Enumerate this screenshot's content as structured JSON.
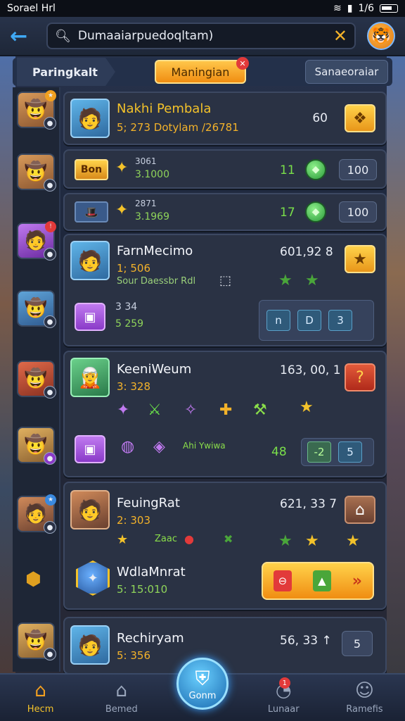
{
  "status": {
    "carrier": "Sorael Hrl",
    "signal": "1/6"
  },
  "search": {
    "query": "Dumaaiarpuedoqltam)"
  },
  "tabs": {
    "left": "Paringkalt",
    "middle": "Maningian",
    "right": "Sanaeoraiar",
    "middle_badge": "✕"
  },
  "rows": [
    {
      "name": "Nakhi Pembala",
      "sub": "5; 273 Dotylam /26781",
      "score": "60"
    },
    {
      "label": "Bon",
      "line1": "3061",
      "line2": "3.1000",
      "gems": "11",
      "pill": "100"
    },
    {
      "line1": "2871",
      "line2": "3.1969",
      "gems": "17",
      "pill": "100"
    },
    {
      "name": "FarnMecimo",
      "sub": "1; 506",
      "desc": "Sour Daessbr Rdl",
      "score": "601,92 8",
      "r1": "3 34",
      "r2": "5 259",
      "slots": [
        "n",
        "D",
        "3"
      ]
    },
    {
      "name": "KeeniWeum",
      "sub": "3: 328",
      "score": "163, 00, 1",
      "items_label": "Ahi Ywiwa",
      "count": "48",
      "slots": [
        "-2",
        "5"
      ]
    },
    {
      "name": "FeuingRat",
      "sub": "2: 303",
      "score": "621, 33 7",
      "mini": "Zaac"
    },
    {
      "name": "WdlaMnrat",
      "sub": "5: 15:010"
    },
    {
      "name": "Rechiryam",
      "sub": "5: 356",
      "score": "56, 33 ↑",
      "pill": "5"
    }
  ],
  "nav": [
    {
      "label": "Hecm",
      "icon": "home-icon"
    },
    {
      "label": "Bemed",
      "icon": "house-icon"
    },
    {
      "label": "Gonm",
      "icon": "shield-icon"
    },
    {
      "label": "Lunaar",
      "icon": "clock-icon",
      "badge": "1"
    },
    {
      "label": "Ramefis",
      "icon": "profile-icon"
    }
  ],
  "colors": {
    "accent": "#f3c22a",
    "blue": "#3fa9f5",
    "green": "#7adf4a"
  }
}
